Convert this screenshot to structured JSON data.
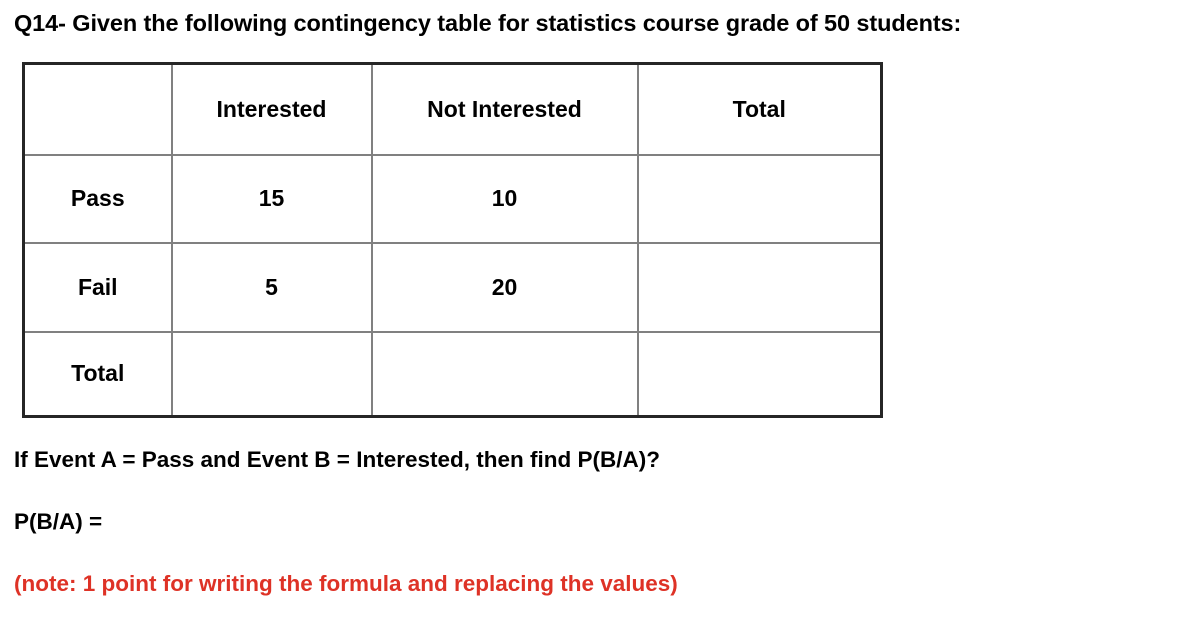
{
  "question": {
    "title": "Q14- Given the following contingency table for statistics course grade of 50 students:",
    "event_definition": "If Event A = Pass and Event B = Interested, then find P(B/A)?",
    "answer_prompt": "P(B/A) =",
    "grading_note": "(note: 1 point for writing the formula and replacing the values)"
  },
  "colors": {
    "note_red": "#DE3226",
    "outer_border": "#262626",
    "inner_border": "#808080",
    "text": "#000000",
    "background": "#ffffff"
  },
  "table": {
    "corner_label": "",
    "columns": [
      "",
      "Interested",
      "Not Interested",
      "Total"
    ],
    "rows": [
      {
        "label": "Pass",
        "cells": [
          "15",
          "10",
          ""
        ]
      },
      {
        "label": "Fail",
        "cells": [
          "5",
          "20",
          ""
        ]
      },
      {
        "label": "Total",
        "cells": [
          "",
          "",
          ""
        ]
      }
    ]
  }
}
